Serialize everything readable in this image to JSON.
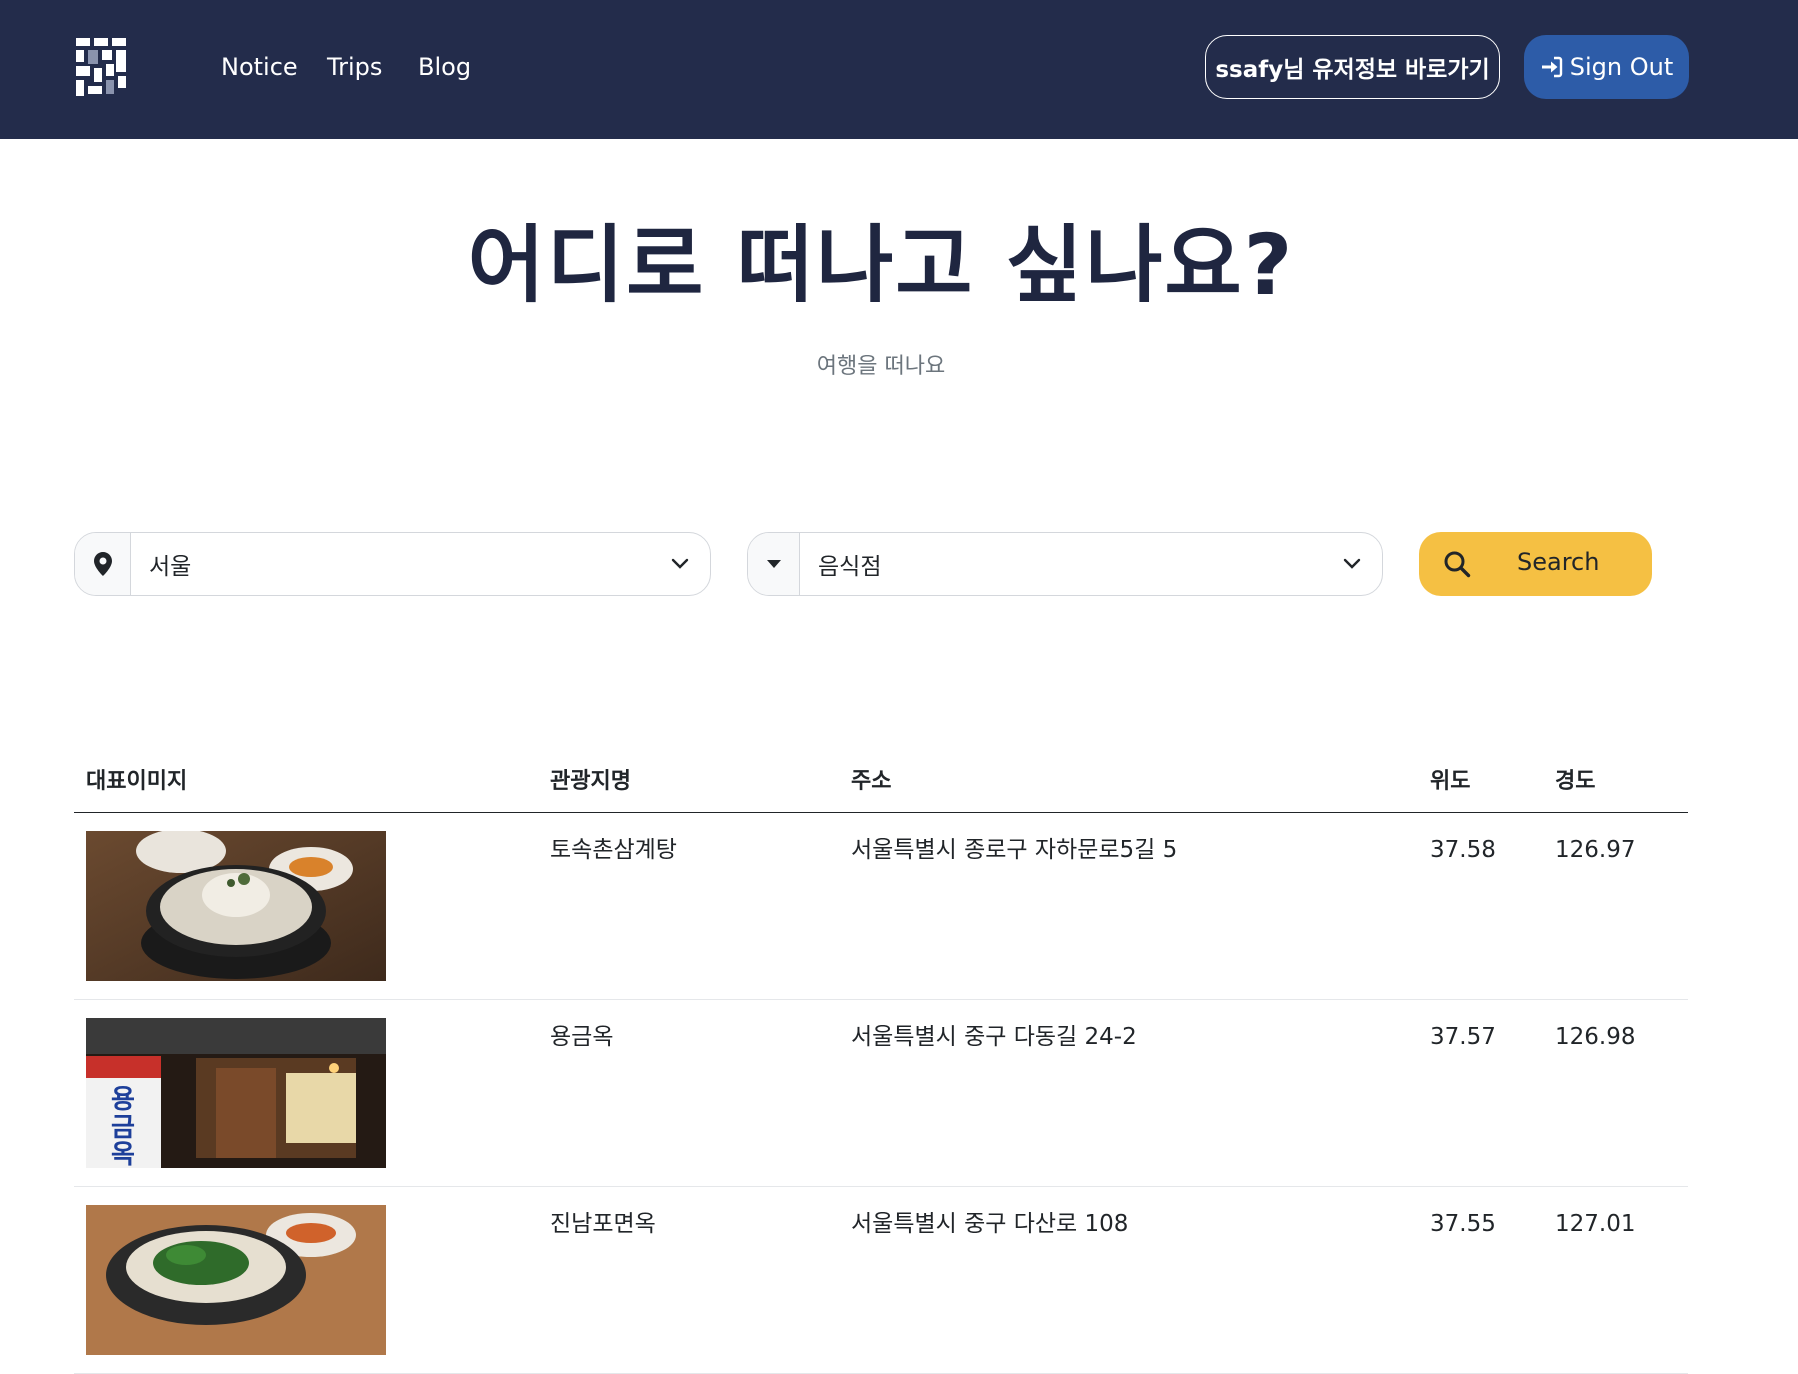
{
  "header": {
    "nav": [
      "Notice",
      "Trips",
      "Blog"
    ],
    "profile_button": "ssafy님 유저정보 바로가기",
    "signout_button": "Sign Out",
    "colors": {
      "bg": "#232c4b",
      "signout": "#2d5ca8"
    }
  },
  "hero": {
    "title": "어디로 떠나고 싶나요?",
    "subtitle": "여행을 떠나요"
  },
  "search": {
    "region_value": "서울",
    "category_value": "음식점",
    "search_button": "Search",
    "icons": [
      "location-pin-icon",
      "caret-down-icon",
      "chevron-down-icon",
      "search-icon"
    ],
    "accent": "#f5c043"
  },
  "table": {
    "headers": [
      "대표이미지",
      "관광지명",
      "주소",
      "위도",
      "경도"
    ],
    "rows": [
      {
        "image": "samgyetang-photo",
        "name": "토속촌삼계탕",
        "address": "서울특별시 종로구 자하문로5길 5",
        "lat": "37.58",
        "lng": "126.97"
      },
      {
        "image": "yonggeumok-storefront-photo",
        "name": "용금옥",
        "address": "서울특별시 중구 다동길 24-2",
        "lat": "37.57",
        "lng": "126.98"
      },
      {
        "image": "naengmyeon-photo",
        "name": "진남포면옥",
        "address": "서울특별시 중구 다산로 108",
        "lat": "37.55",
        "lng": "127.01"
      }
    ]
  }
}
